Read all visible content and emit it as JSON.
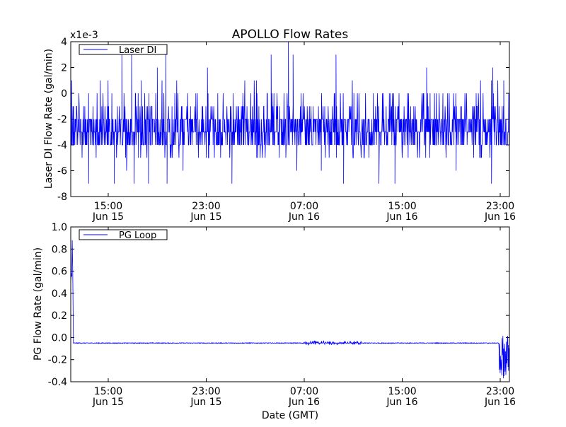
{
  "chart_data": [
    {
      "type": "line",
      "title": "APOLLO Flow Rates",
      "xlabel": "",
      "ylabel": "Laser DI Flow Rate (gal/min)",
      "y_scale_label": "x1e-3",
      "ylim": [
        -8,
        4
      ],
      "yticks": [
        -8,
        -6,
        -4,
        -2,
        0,
        2,
        4
      ],
      "ytick_labels": [
        "-8",
        "-6",
        "-4",
        "-2",
        "0",
        "2",
        "4"
      ],
      "x_units": "hours since Jun 15 00:00 GMT",
      "xlim": [
        11.94,
        47.75
      ],
      "xticks": [
        15,
        23,
        31,
        39,
        47
      ],
      "xtick_labels": [
        [
          "15:00",
          "Jun 15"
        ],
        [
          "23:00",
          "Jun 15"
        ],
        [
          "07:00",
          "Jun 16"
        ],
        [
          "15:00",
          "Jun 16"
        ],
        [
          "23:00",
          "Jun 16"
        ]
      ],
      "legend": {
        "placement": "top-left",
        "entries": [
          "Laser DI"
        ]
      },
      "grid": false,
      "series": [
        {
          "name": "Laser DI",
          "color": "#0000ff",
          "typical_values_x1e-3": [
            -2,
            -3,
            -4
          ],
          "spikes": [
            {
              "x": 13.4,
              "y": -7
            },
            {
              "x": 15.5,
              "y": -7
            },
            {
              "x": 16.1,
              "y": 3
            },
            {
              "x": 16.5,
              "y": -6
            },
            {
              "x": 16.9,
              "y": 3
            },
            {
              "x": 17.1,
              "y": -7
            },
            {
              "x": 18.3,
              "y": -7
            },
            {
              "x": 19.0,
              "y": 2
            },
            {
              "x": 19.7,
              "y": 3
            },
            {
              "x": 19.8,
              "y": -7
            },
            {
              "x": 21.1,
              "y": -6
            },
            {
              "x": 23.1,
              "y": 2
            },
            {
              "x": 25.1,
              "y": -7
            },
            {
              "x": 28.3,
              "y": 3
            },
            {
              "x": 29.7,
              "y": 4
            },
            {
              "x": 30.1,
              "y": 3
            },
            {
              "x": 30.4,
              "y": -6
            },
            {
              "x": 32.4,
              "y": -6
            },
            {
              "x": 33.6,
              "y": 3
            },
            {
              "x": 34.2,
              "y": -7
            },
            {
              "x": 37.1,
              "y": -7
            },
            {
              "x": 38.4,
              "y": -7
            },
            {
              "x": 41.0,
              "y": 2
            },
            {
              "x": 43.4,
              "y": -6
            },
            {
              "x": 46.3,
              "y": -7
            },
            {
              "x": 46.4,
              "y": 2
            },
            {
              "x": 47.3,
              "y": 1
            }
          ]
        }
      ]
    },
    {
      "type": "line",
      "xlabel": "Date (GMT)",
      "ylabel": "PG Flow Rate (gal/min)",
      "ylim": [
        -0.4,
        1.0
      ],
      "yticks": [
        -0.4,
        -0.2,
        0.0,
        0.2,
        0.4,
        0.6,
        0.8,
        1.0
      ],
      "ytick_labels": [
        "-0.4",
        "-0.2",
        "0.0",
        "0.2",
        "0.4",
        "0.6",
        "0.8",
        "1.0"
      ],
      "x_units": "hours since Jun 15 00:00 GMT",
      "xlim": [
        11.94,
        47.75
      ],
      "xticks": [
        15,
        23,
        31,
        39,
        47
      ],
      "xtick_labels": [
        [
          "15:00",
          "Jun 15"
        ],
        [
          "23:00",
          "Jun 15"
        ],
        [
          "07:00",
          "Jun 16"
        ],
        [
          "15:00",
          "Jun 16"
        ],
        [
          "23:00",
          "Jun 16"
        ]
      ],
      "legend": {
        "placement": "top-left",
        "entries": [
          "PG Loop"
        ]
      },
      "grid": false,
      "series": [
        {
          "name": "PG Loop",
          "color": "#0000ff",
          "initial_points": [
            [
              11.94,
              0.5
            ],
            [
              11.98,
              0.58
            ],
            [
              12.02,
              0.55
            ],
            [
              12.06,
              0.88
            ],
            [
              12.1,
              0.6
            ],
            [
              12.16,
              -0.05
            ],
            [
              12.2,
              -0.05
            ]
          ],
          "baseline": -0.05,
          "noisy_segment": {
            "x_start": 31.0,
            "x_end": 35.7,
            "min": -0.07,
            "max": -0.03
          },
          "final_segment": {
            "x_start": 46.9,
            "x_end": 47.75,
            "min": -0.37,
            "max": 0.03
          }
        }
      ]
    }
  ]
}
